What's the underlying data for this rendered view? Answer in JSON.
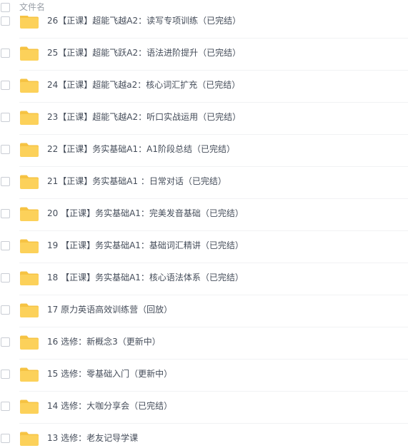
{
  "header": {
    "column_label": "文件名"
  },
  "files": [
    {
      "name": "26【正课】超能飞越A2：读写专项训练（已完结）",
      "icon": "folder-icon"
    },
    {
      "name": "25【正课】超能飞跃A2：语法进阶提升（已完结）",
      "icon": "folder-icon"
    },
    {
      "name": "24【正课】超能飞越a2：核心词汇扩充（已完结）",
      "icon": "folder-icon"
    },
    {
      "name": "23【正课】超能飞越A2：听口实战运用（已完结）",
      "icon": "folder-icon"
    },
    {
      "name": "22【正课】务实基础A1：A1阶段总结（已完结）",
      "icon": "folder-icon"
    },
    {
      "name": "21【正课】务实基础A1 ：日常对话（已完结）",
      "icon": "folder-icon"
    },
    {
      "name": "20 【正课】务实基础A1：完美发音基础（已完结）",
      "icon": "folder-icon"
    },
    {
      "name": "19 【正课】务实基础A1：基础词汇精讲（已完结）",
      "icon": "folder-icon"
    },
    {
      "name": "18 【正课】务实基础A1：核心语法体系（已完结）",
      "icon": "folder-icon"
    },
    {
      "name": "17 原力英语高效训练营（回放）",
      "icon": "folder-icon"
    },
    {
      "name": "16 选修：新概念3（更新中）",
      "icon": "folder-icon"
    },
    {
      "name": "15 选修：零基础入门（更新中）",
      "icon": "folder-icon"
    },
    {
      "name": "14 选修：大咖分享会（已完结）",
      "icon": "folder-icon"
    },
    {
      "name": "13 选修：老友记导学课",
      "icon": "folder-icon"
    }
  ],
  "colors": {
    "folder": "#fcd15a",
    "folder_tab": "#f6c343",
    "text": "#454d5a",
    "header_text": "#9aa0a8"
  }
}
